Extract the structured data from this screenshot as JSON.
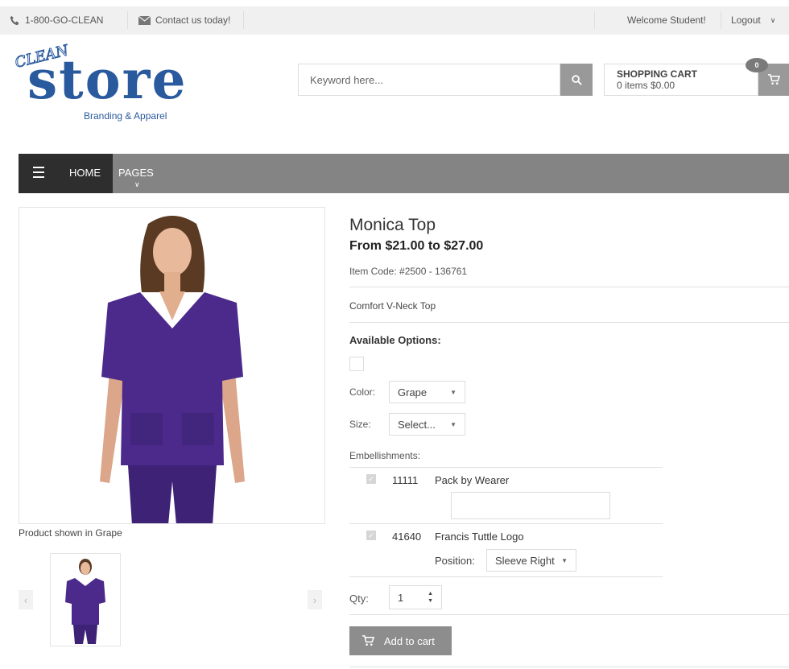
{
  "topbar": {
    "phone": "1-800-GO-CLEAN",
    "contact": "Contact us today!",
    "welcome": "Welcome Student!",
    "logout": "Logout"
  },
  "logo": {
    "clean": "CLEAN",
    "store": "store",
    "tagline": "Branding & Apparel"
  },
  "search": {
    "placeholder": "Keyword here..."
  },
  "cart": {
    "title": "SHOPPING CART",
    "summary": "0 items $0.00",
    "badge": "0"
  },
  "nav": {
    "home": "HOME",
    "pages": "PAGES"
  },
  "product": {
    "title": "Monica Top",
    "price": "From $21.00 to $27.00",
    "item_code": "Item Code: #2500 - 136761",
    "description": "Comfort V-Neck Top",
    "image_caption": "Product shown in Grape",
    "available_options_label": "Available Options:",
    "color_label": "Color:",
    "color_value": "Grape",
    "size_label": "Size:",
    "size_value": "Select...",
    "embellishments_label": "Embellishments:",
    "embellishments": [
      {
        "code": "11111",
        "name": "Pack by Wearer"
      },
      {
        "code": "41640",
        "name": "Francis Tuttle Logo"
      }
    ],
    "position_label": "Position:",
    "position_value": "Sleeve Right",
    "qty_label": "Qty:",
    "qty_value": "1",
    "add_to_cart": "Add to cart"
  },
  "colors": {
    "garment": "#4b2a8c",
    "brand_blue": "#2a5a9e",
    "nav_dark": "#2e2e2e",
    "nav_gray": "#848484"
  }
}
